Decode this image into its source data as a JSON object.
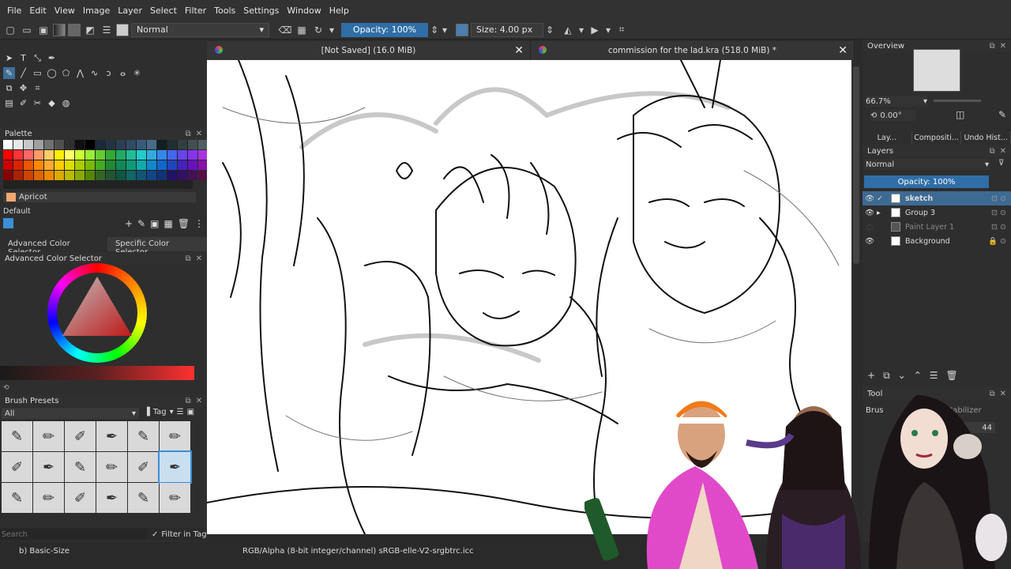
{
  "menubar": {
    "items": [
      "File",
      "Edit",
      "View",
      "Image",
      "Layer",
      "Select",
      "Filter",
      "Tools",
      "Settings",
      "Window",
      "Help"
    ]
  },
  "toolbar": {
    "blend_mode": "Normal",
    "opacity": "Opacity: 100%",
    "size": "Size: 4.00 px"
  },
  "left_dock": {
    "palette": {
      "title": "Palette",
      "color_name": "Apricot",
      "tag": "Default",
      "swatch_colors": [
        "#ffffff",
        "#e8e8e8",
        "#c8c8c8",
        "#a0a0a0",
        "#707070",
        "#505050",
        "#303030",
        "#101010",
        "#000000",
        "#1b2a3a",
        "#223344",
        "#2a3f55",
        "#314b66",
        "#3a5a7a",
        "#4a6a8a",
        "#102020",
        "#203030",
        "#304040",
        "#405050",
        "#506060",
        "#ff0000",
        "#ff3333",
        "#ff6666",
        "#ff9966",
        "#ffcc66",
        "#ffee00",
        "#ffff66",
        "#ccff33",
        "#99ee33",
        "#66cc33",
        "#33aa33",
        "#22aa66",
        "#22bb99",
        "#22cccc",
        "#33aadd",
        "#3388ee",
        "#4466ee",
        "#6644ee",
        "#8833ee",
        "#aa33dd",
        "#cc0000",
        "#dd2200",
        "#ee5500",
        "#ff8800",
        "#ffaa33",
        "#ffcc00",
        "#dddd00",
        "#aacc00",
        "#77bb00",
        "#44aa22",
        "#228833",
        "#118855",
        "#119977",
        "#11aaaa",
        "#1188cc",
        "#1166cc",
        "#2244bb",
        "#4422bb",
        "#6611bb",
        "#8811aa",
        "#880000",
        "#aa2200",
        "#cc4400",
        "#dd6600",
        "#ee8800",
        "#ddaa00",
        "#bbbb00",
        "#88aa00",
        "#558800",
        "#336622",
        "#225533",
        "#115544",
        "#116666",
        "#115577",
        "#114488",
        "#113377",
        "#221166",
        "#331166",
        "#441155",
        "#551144"
      ]
    },
    "color_tabs": [
      "Advanced Color Selector",
      "Specific Color Selector"
    ],
    "advanced_color_title": "Advanced Color Selector",
    "brush_presets": {
      "title": "Brush Presets",
      "filter": "All",
      "tag_label": "Tag",
      "search_placeholder": "Search",
      "filter_in_tag": "Filter in Tag"
    }
  },
  "canvas": {
    "tabs": [
      {
        "label": "[Not Saved]  (16.0 MiB)"
      },
      {
        "label": "commission for the lad.kra  (518.0 MiB) *"
      }
    ]
  },
  "right_dock": {
    "overview_title": "Overview",
    "zoom": "66.7%",
    "rotation": "0.00°",
    "tabs": [
      "Lay...",
      "Compositi...",
      "Undo Hist..."
    ],
    "layers_title": "Layers",
    "blend_mode": "Normal",
    "opacity": "Opacity:  100%",
    "layers": [
      {
        "name": "sketch",
        "selected": true
      },
      {
        "name": "Group 3",
        "selected": false
      },
      {
        "name": "Paint Layer 1",
        "selected": false
      },
      {
        "name": "Background",
        "selected": false
      }
    ],
    "tool_options_title": "Tool",
    "brush_label": "Brus",
    "stabilizer": "Stabilizer",
    "value": "44"
  },
  "statusbar": {
    "brush": "b) Basic-Size",
    "color_profile": "RGB/Alpha (8-bit integer/channel)  sRGB-elle-V2-srgbtrc.icc"
  },
  "colors": {
    "accent": "#3b8fd6",
    "selection": "#3d6a93"
  }
}
